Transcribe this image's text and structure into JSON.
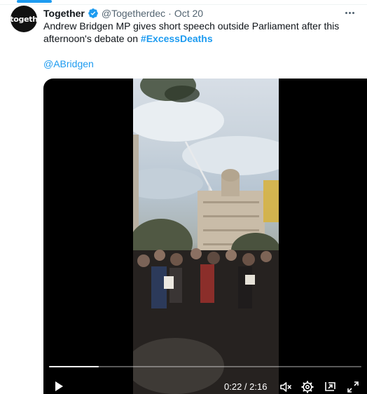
{
  "tweet": {
    "display_name": "Together",
    "handle": "@Togetherdec",
    "separator": "·",
    "date": "Oct 20",
    "text_before": "Andrew Bridgen MP gives short speech outside Parliament after this afternoon's debate on ",
    "hashtag": "#ExcessDeaths",
    "mention": "@ABridgen",
    "avatar_text": "togeth"
  },
  "video": {
    "current_time": "0:22",
    "duration": "2:16",
    "time_separator": " / ",
    "progress_fraction": 0.16
  },
  "colors": {
    "accent": "#1d9bf0",
    "text_primary": "#0f1419",
    "text_secondary": "#536471"
  },
  "icons": {
    "verified": "verified-badge-icon",
    "more": "more-icon",
    "play": "play-icon",
    "mute": "mute-icon",
    "settings": "settings-icon",
    "pip": "picture-in-picture-icon",
    "fullscreen": "fullscreen-icon"
  }
}
